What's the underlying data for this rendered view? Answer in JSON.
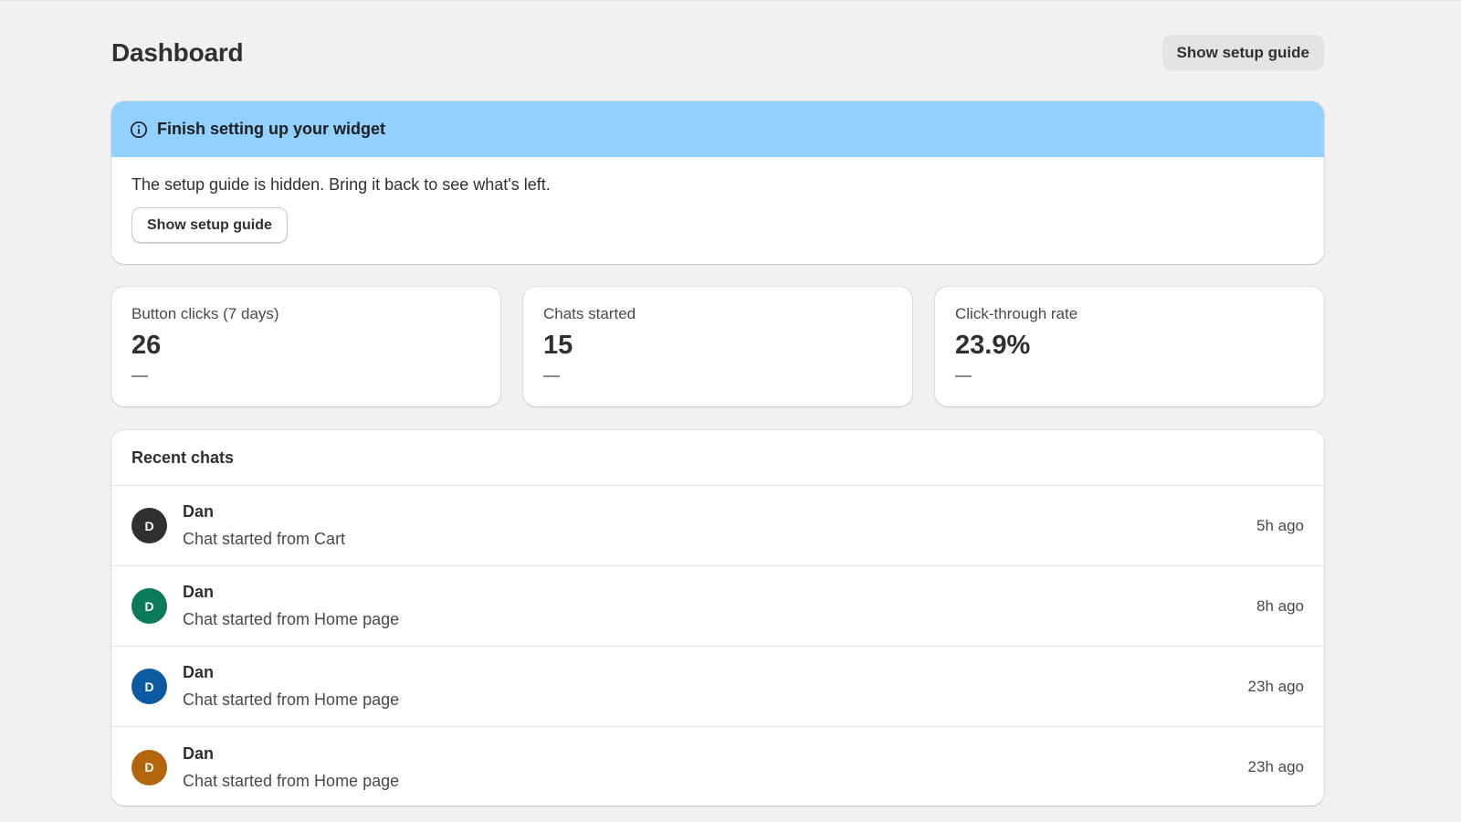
{
  "header": {
    "title": "Dashboard",
    "setup_button_label": "Show setup guide"
  },
  "banner": {
    "title": "Finish setting up your widget",
    "icon": "info-icon",
    "color": "#91d0ff",
    "message": "The setup guide is hidden. Bring it back to see what's left.",
    "button_label": "Show setup guide"
  },
  "metrics": [
    {
      "label": "Button clicks (7 days)",
      "value": "26",
      "trend": "—"
    },
    {
      "label": "Chats started",
      "value": "15",
      "trend": "—"
    },
    {
      "label": "Click-through rate",
      "value": "23.9%",
      "trend": "—"
    }
  ],
  "recent_chats": {
    "title": "Recent chats",
    "items": [
      {
        "initial": "D",
        "name": "Dan",
        "source": "Chat started from Cart",
        "time": "5h ago",
        "avatar_color": "#303030"
      },
      {
        "initial": "D",
        "name": "Dan",
        "source": "Chat started from Home page",
        "time": "8h ago",
        "avatar_color": "#0b7a5a"
      },
      {
        "initial": "D",
        "name": "Dan",
        "source": "Chat started from Home page",
        "time": "23h ago",
        "avatar_color": "#0e5aa1"
      },
      {
        "initial": "D",
        "name": "Dan",
        "source": "Chat started from Home page",
        "time": "23h ago",
        "avatar_color": "#b3650b"
      }
    ]
  }
}
